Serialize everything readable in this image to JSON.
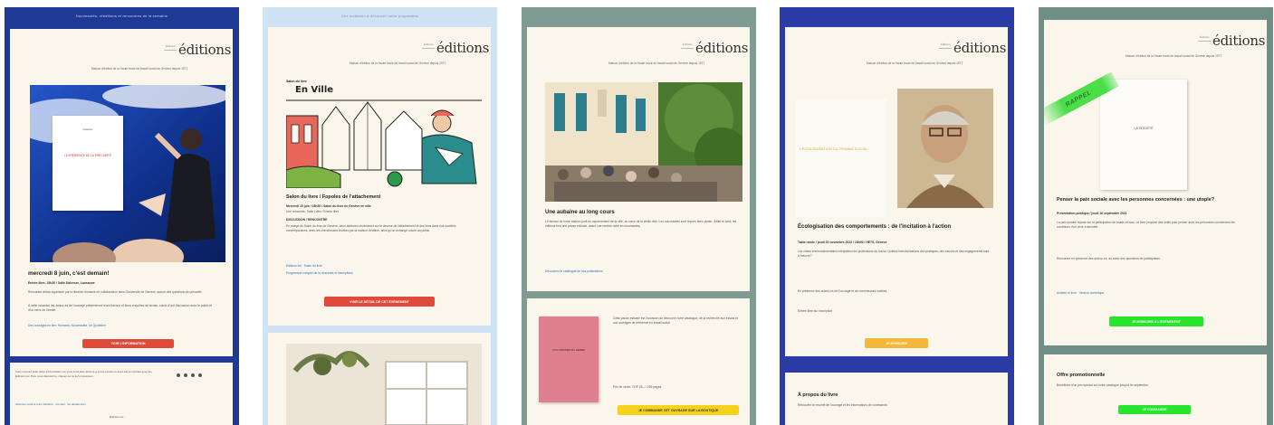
{
  "colors": {
    "panel1_bg": "#1f3a96",
    "panel2_bg": "#cfe3f4",
    "panel3_bg": "#7f9b94",
    "panel4_bg": "#2b3ca6",
    "panel5_bg": "#6f8e86",
    "card_bg": "#fbf6ec",
    "button_red": "#e04a3a",
    "button_yellow": "#f6d21d",
    "button_orange": "#f6b637",
    "button_green": "#27e42c",
    "rappel_green": "#4bde49"
  },
  "brand": {
    "name": "éditions",
    "prefix": "Éditions",
    "tagline": "Maison d'édition de la Haute école de travail social de Genève depuis 1977"
  },
  "panels": [
    {
      "topbar": "Nouveautés, rééditions et rencontres de la semaine",
      "book_title": "L'EXPÉRIENCE DE LA PRÉCARITÉ",
      "book_meta": "Collection",
      "headline": "mercredi 8 juin, c'est demain!",
      "meta": "Entrée libre, 19h30 / Salle Dalcroze, Lausanne",
      "para1": "Rencontre-débat organisée par la librairie Humanis en collaboration avec l'Université de Genève, autour des questions de précarité.",
      "para2": "À cette occasion les auteur-es de l'ouvrage présenteront leurs travaux et leurs enquêtes de terrain, suivis d'une discussion avec le public et d'un verre de l'amitié.",
      "link": "Des ouvrages en lien: Humanis, Nouveautés, Le Quotidien",
      "button": "VOIR L'INFORMATION",
      "footer_text": "Vous recevez cette lettre d'information car vous vous êtes abonné-e à nos envois ou avez été en contact avec les Éditions ies. Pour vous désinscrire, cliquez sur le lien ci-dessous.",
      "footer_links": "Abonnez-vous à notre infolettre · Contact · Se désabonner",
      "footer_address": "Éditions ies"
    },
    {
      "topbar": "Une invitation à découvrir notre programme",
      "illustration_title_small": "Salon du livre",
      "illustration_title": "En Ville",
      "headline": "Salon du livre / Fopoles de l'attachement",
      "meta": "Mercredi 15 juin / 18h30 / Salon du livre de Genève en ville",
      "meta2": "Une rencontre, Salle Lullin / Entrée libre",
      "section": "DISCUSSION / RENCONTRE",
      "para": "En marge du Salon du livre de Genève, deux auteures reviendront sur le devenir de l'attachement et des liens dans nos sociétés contemporaines, avec les chercheuses invitées par la maison d'édition, ainsi qu'un échange ouvert au public.",
      "link": "Éditions ies · Salon du livre",
      "link2": "Programme complet de la rencontre et inscriptions",
      "button": "VOIR LE DÉTAIL DE CET ÉVÉNEMENT"
    },
    {
      "topbar": "",
      "headline": "Une aubaine au long cours",
      "para": "Le bureau de notre maison jouit du rayonnement de la ville, au cœur de la vieille ville. Les nouveautés sont reçues avec plaisir. Juillet et août, les éditions font une pause estivale, avant une rentrée riche en nouveautés.",
      "link": "Découvrez le catalogue de nos publications",
      "book_title": "AUX ORIGINES DU GENRE",
      "desc": "Cette pause estivale est l'occasion de découvrir notre catalogue, de la recherche aux essais et aux ouvrages de référence en travail social.",
      "price": "Prix de vente: CHF 25.– / 256 pages",
      "button": "JE COMMANDE CET OUVRAGE SUR LA BOUTIQUE"
    },
    {
      "topbar": "",
      "book_title": "L'ÉCOLOGISATION DU TRAVAIL SOCIAL",
      "headline": "Écologisation des comportements : de l'incitation à l'action",
      "meta": "Table ronde / jeudi 23 novembre 2023 / 18h00 / HETS, Genève",
      "para": "Les crises environnementales interpellent les professions du social. Quelles transformations des pratiques, des savoirs et des engagements sont à l'œuvre?",
      "para2": "En présence des auteur-es de l'ouvrage et de chercheuses invitées.",
      "footer_line": "Entrée libre sur inscription",
      "button": "JE M'INSCRIS",
      "section_title": "À propos du livre",
      "section_text": "Retrouvez le résumé de l'ouvrage et les informations de commande."
    },
    {
      "topbar": "",
      "stamp": "RAPPEL",
      "book_title": "LA SOCIÉTÉ",
      "headline": "Penser la paix sociale avec les personnes concernées : une utopie?",
      "meta": "Présentation publique / jeudi 16 septembre 2021",
      "para": "La paix sociale repose sur la participation de toutes et tous. Le livre propose des outils pour penser avec les personnes concernées les conditions d'un vivre-ensemble.",
      "para2": "Rencontre en présence des auteur-es, au cœur des questions de participation.",
      "link": "Acheter le livre · Version numérique",
      "button": "JE M'INSCRIS À L'ÉVÉNEMENT",
      "section_title": "Offre promotionnelle",
      "section_text": "Bénéficiez d'un prix spécial sur notre catalogue jusqu'à fin septembre.",
      "button2": "JE COMMANDE"
    }
  ]
}
